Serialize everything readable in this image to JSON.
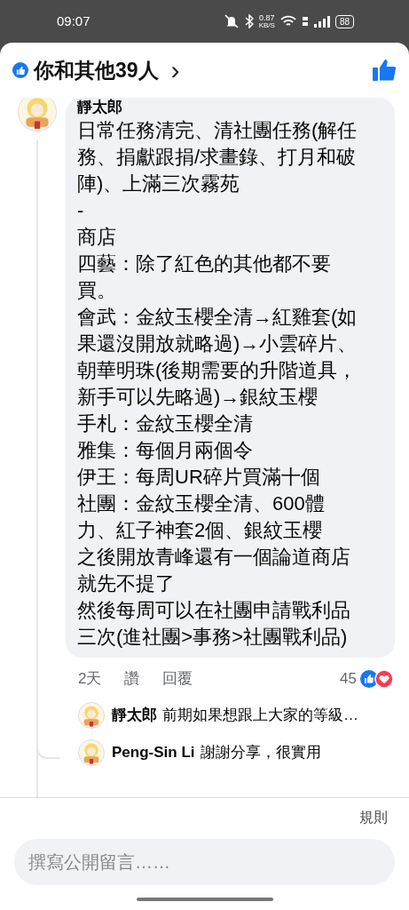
{
  "status_bar": {
    "time": "09:07",
    "net_speed": "0.87",
    "net_unit": "KB/S",
    "battery": "88"
  },
  "header": {
    "title": "你和其他39人",
    "chevron": "›"
  },
  "comment": {
    "author": "靜太郎",
    "paragraphs": [
      "日常任務清完、清社團任務(解任務、捐獻跟捐/求畫錄、打月和破陣)、上滿三次霧苑",
      "-",
      "商店",
      "四藝：除了紅色的其他都不要買。",
      "會武：金紋玉櫻全清→紅雞套(如果還沒開放就略過)→小雲碎片、朝華明珠(後期需要的升階道具，新手可以先略過)→銀紋玉櫻",
      "手札：金紋玉櫻全清",
      "雅集：每個月兩個令",
      "伊王：每周UR碎片買滿十個",
      "社團：金紋玉櫻全清、600體力、紅子神套2個、銀紋玉櫻",
      "之後開放青峰還有一個論道商店就先不提了",
      "然後每周可以在社團申請戰利品三次(進社團>事務>社團戰利品)"
    ],
    "time": "2天",
    "like": "讚",
    "reply": "回覆",
    "reaction_count": "45"
  },
  "replies": [
    {
      "author": "靜太郎",
      "text": "前期如果想跟上大家的等級…"
    },
    {
      "author": "Peng-Sin Li",
      "text": "謝謝分享，很實用"
    }
  ],
  "footer": {
    "rules": "規則",
    "placeholder": "撰寫公開留言……"
  }
}
